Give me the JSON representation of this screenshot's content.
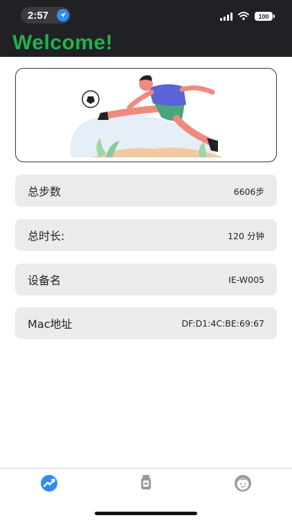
{
  "status_bar": {
    "time": "2:57",
    "battery": "100"
  },
  "header": {
    "title": "Welcome!"
  },
  "colors": {
    "header_bg": "#1f2125",
    "title_green": "#22b14c",
    "card_bg": "#ebebeb",
    "tab_active": "#2f8cf5",
    "tab_inactive": "#9a9a9a"
  },
  "banner": {
    "image": "soccer-player-kicking-ball-illustration"
  },
  "info_cards": {
    "steps": {
      "label": "总步数",
      "value": "6606步"
    },
    "duration": {
      "label": "总时长:",
      "value": "120 分钟"
    },
    "device": {
      "label": "设备名",
      "value": "IE-W005"
    },
    "mac": {
      "label": "Mac地址",
      "value": "DF:D1:4C:BE:69:67"
    }
  },
  "tab_bar": {
    "tabs": [
      {
        "icon": "activity-chart-icon",
        "active": true
      },
      {
        "icon": "watch-device-icon",
        "active": false
      },
      {
        "icon": "profile-face-icon",
        "active": false
      }
    ]
  }
}
